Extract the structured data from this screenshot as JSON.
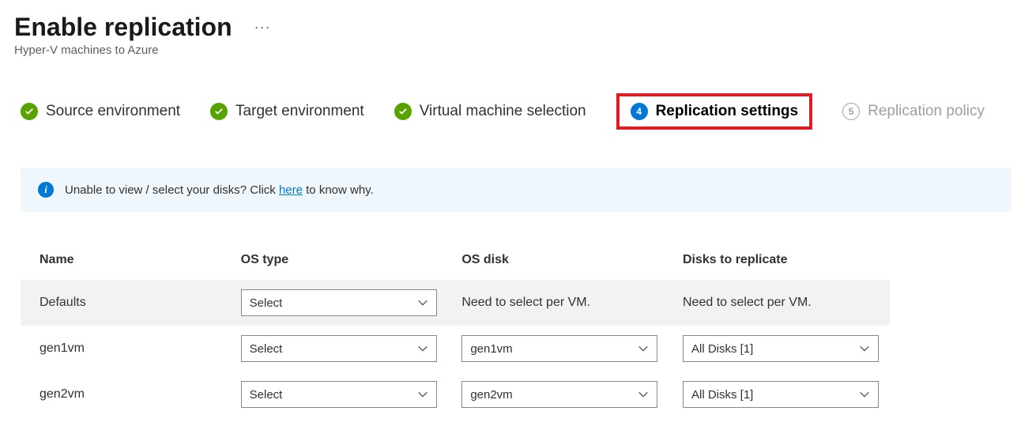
{
  "header": {
    "title": "Enable replication",
    "subtitle": "Hyper-V machines to Azure"
  },
  "steps": {
    "s1": "Source environment",
    "s2": "Target environment",
    "s3": "Virtual machine selection",
    "s4_num": "4",
    "s4": "Replication settings",
    "s5_num": "5",
    "s5": "Replication policy"
  },
  "banner": {
    "text_before": "Unable to view / select your disks? Click ",
    "link": "here",
    "text_after": " to know why."
  },
  "table": {
    "headers": {
      "name": "Name",
      "os_type": "OS type",
      "os_disk": "OS disk",
      "disks": "Disks to replicate"
    },
    "defaults": {
      "name": "Defaults",
      "os_type": "Select",
      "os_disk": "Need to select per VM.",
      "disks": "Need to select per VM."
    },
    "rows": [
      {
        "name": "gen1vm",
        "os_type": "Select",
        "os_disk": "gen1vm",
        "disks": "All Disks [1]"
      },
      {
        "name": "gen2vm",
        "os_type": "Select",
        "os_disk": "gen2vm",
        "disks": "All Disks [1]"
      }
    ]
  }
}
